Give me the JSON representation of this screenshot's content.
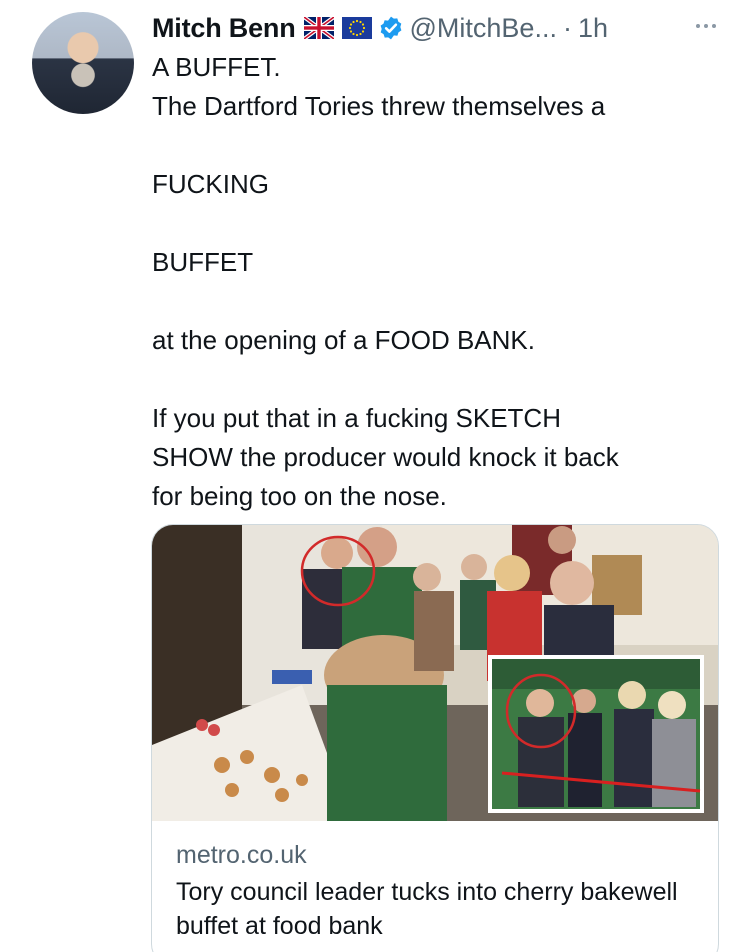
{
  "author": {
    "name": "Mitch Benn",
    "handle": "@MitchBe...",
    "separator": "·",
    "time": "1h"
  },
  "icons": {
    "flags": [
      "uk-flag-icon",
      "eu-flag-icon"
    ],
    "verified": "verified-badge-icon",
    "more": "more-options-icon"
  },
  "tweet": {
    "line1": "A BUFFET.",
    "line2": "The Dartford Tories threw themselves a",
    "line3": "FUCKING",
    "line4": "BUFFET",
    "line5": "at the opening of a FOOD BANK.",
    "line6": "If you put that in a fucking SKETCH\nSHOW the producer would knock it back\nfor being too on the nose."
  },
  "link_card": {
    "domain": "metro.co.uk",
    "title": "Tory council leader tucks into cherry bakewell buffet at food bank"
  },
  "colors": {
    "text": "#0f1419",
    "secondary": "#536471",
    "verified": "#1d9bf0",
    "border": "#cfd9de"
  }
}
